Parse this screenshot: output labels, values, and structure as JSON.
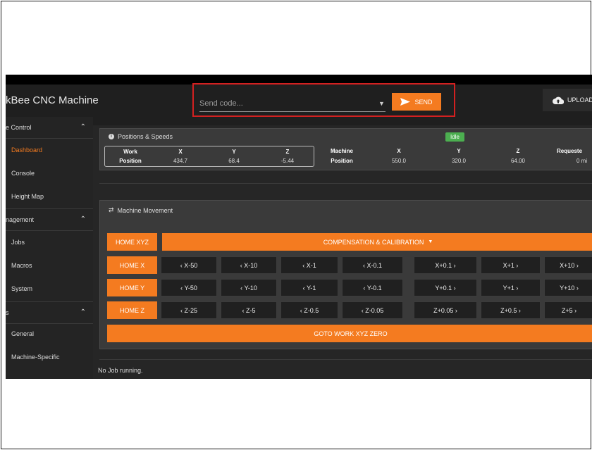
{
  "app": {
    "title": "kBee CNC Machine"
  },
  "toolbar": {
    "code_placeholder": "Send code...",
    "send_label": "SEND",
    "upload_label": "UPLOAD"
  },
  "sidebar": {
    "sections": [
      {
        "label": "e Control"
      },
      {
        "label": "nagement"
      },
      {
        "label": "s"
      }
    ],
    "items": [
      {
        "label": "Dashboard",
        "active": true
      },
      {
        "label": "Console"
      },
      {
        "label": "Height Map"
      },
      {
        "label": "Jobs"
      },
      {
        "label": "Macros"
      },
      {
        "label": "System"
      },
      {
        "label": "General"
      },
      {
        "label": "Machine-Specific"
      }
    ]
  },
  "positions": {
    "title": "Positions & Speeds",
    "status": "Idle",
    "work": {
      "label1": "Work",
      "label2": "Position",
      "x": "434.7",
      "y": "68.4",
      "z": "-5.44"
    },
    "machine": {
      "label1": "Machine",
      "label2": "Position",
      "x": "550.0",
      "y": "320.0",
      "z": "64.00"
    },
    "axes": {
      "x": "X",
      "y": "Y",
      "z": "Z"
    },
    "requested": {
      "label": "Requeste",
      "value": "0 mi"
    }
  },
  "movement": {
    "title": "Machine Movement",
    "home_xyz": "HOME XYZ",
    "compensation": "COMPENSATION & CALIBRATION",
    "home_x": "HOME X",
    "home_y": "HOME Y",
    "home_z": "HOME Z",
    "x_buttons": [
      "X-50",
      "X-10",
      "X-1",
      "X-0.1",
      "X+0.1",
      "X+1",
      "X+10"
    ],
    "y_buttons": [
      "Y-50",
      "Y-10",
      "Y-1",
      "Y-0.1",
      "Y+0.1",
      "Y+1",
      "Y+10"
    ],
    "z_buttons": [
      "Z-25",
      "Z-5",
      "Z-0.5",
      "Z-0.05",
      "Z+0.05",
      "Z+0.5",
      "Z+5"
    ],
    "goto_zero": "GOTO WORK XYZ ZERO"
  },
  "status_text": "No Job running.",
  "colors": {
    "accent": "#f47b20",
    "idle": "#4caf50",
    "highlight_border": "#d32020"
  }
}
